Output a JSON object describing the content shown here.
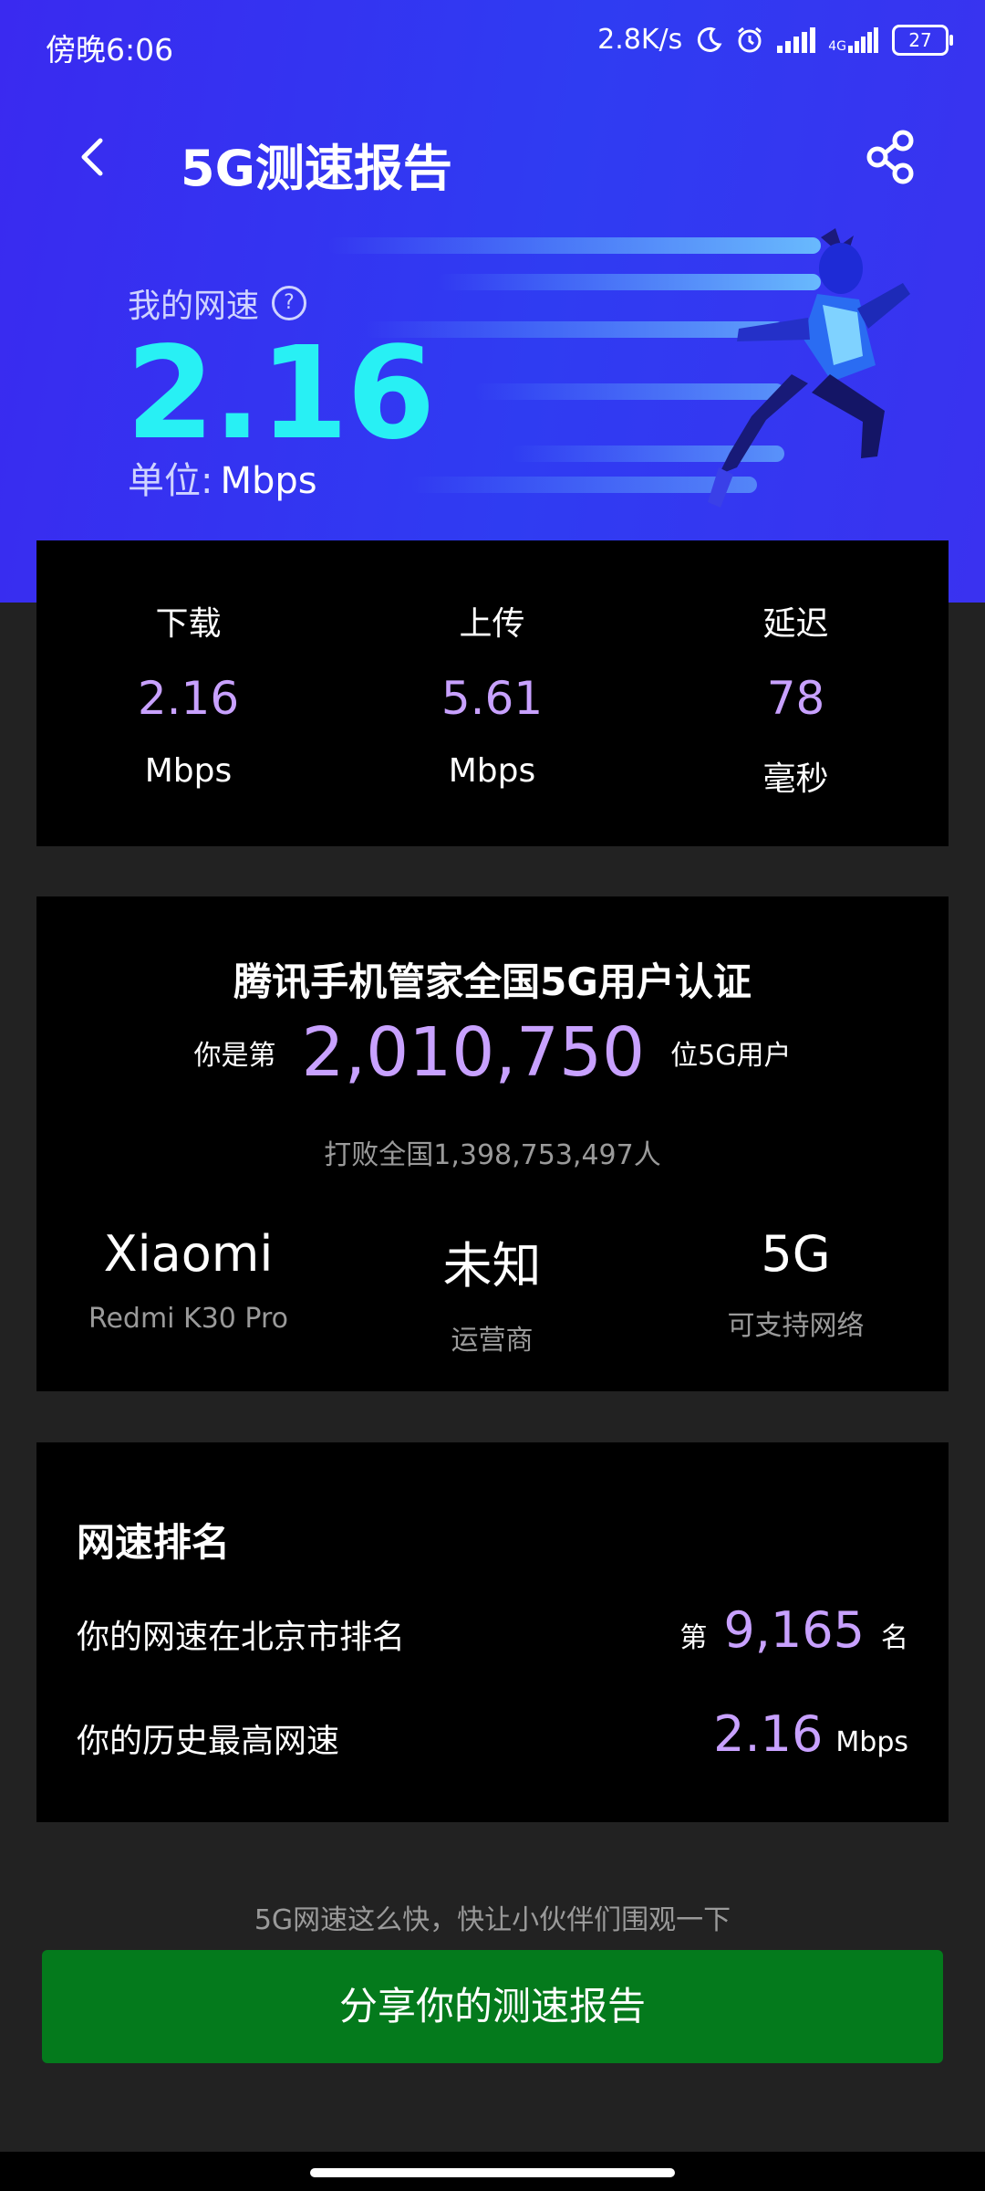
{
  "status_bar": {
    "time": "傍晚6:06",
    "net_speed": "2.8K/s",
    "network_type": "4G",
    "battery": "27",
    "icons": [
      "moon-icon",
      "alarm-icon",
      "signal-icon",
      "signal-4g-icon",
      "battery-icon"
    ]
  },
  "header": {
    "title": "5G测速报告",
    "back_icon": "chevron-left-icon",
    "share_icon": "share-icon"
  },
  "hero": {
    "speed_label": "我的网速",
    "help_glyph": "?",
    "speed_value": "2.16",
    "unit_label": "单位:",
    "unit_value": "Mbps"
  },
  "stats": [
    {
      "label": "下载",
      "value": "2.16",
      "unit": "Mbps"
    },
    {
      "label": "上传",
      "value": "5.61",
      "unit": "Mbps"
    },
    {
      "label": "延迟",
      "value": "78",
      "unit": "毫秒"
    }
  ],
  "certification": {
    "title": "腾讯手机管家全国5G用户认证",
    "rank_prefix": "你是第",
    "rank_number": "2,010,750",
    "rank_suffix": "位5G用户",
    "beat_text": "打败全国1,398,753,497人",
    "device": [
      {
        "value": "Xiaomi",
        "sub": "Redmi K30 Pro"
      },
      {
        "value": "未知",
        "sub": "运营商"
      },
      {
        "value": "5G",
        "sub": "可支持网络"
      }
    ]
  },
  "ranking": {
    "title": "网速排名",
    "city_rank_label": "你的网速在北京市排名",
    "city_rank_prefix": "第",
    "city_rank_value": "9,165",
    "city_rank_suffix": "名",
    "max_speed_label": "你的历史最高网速",
    "max_speed_value": "2.16",
    "max_speed_unit": "Mbps"
  },
  "footer": {
    "invite_text": "5G网速这么快，快让小伙伴们围观一下",
    "share_button": "分享你的测速报告"
  },
  "colors": {
    "hero_bg": "#3a2af0",
    "speed_accent": "#28f0f4",
    "value_purple": "#c8a1ff",
    "button_green": "#047a1c",
    "page_bg": "#222222",
    "card_bg": "#000000"
  }
}
